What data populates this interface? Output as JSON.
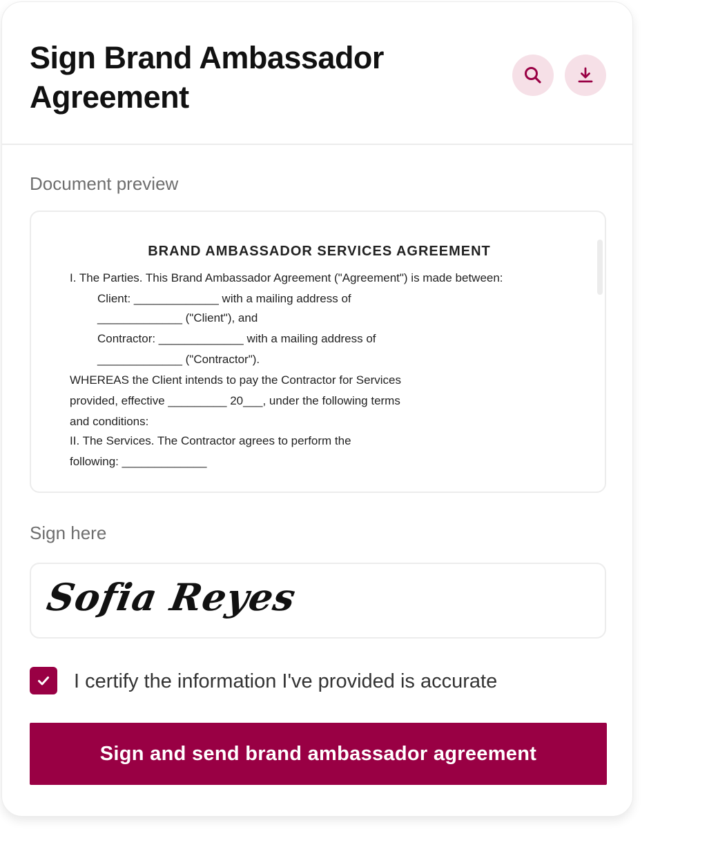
{
  "header": {
    "title": "Sign Brand Ambassador Agreement",
    "search_icon": "search-icon",
    "download_icon": "download-icon"
  },
  "preview": {
    "label": "Document preview",
    "doc_title": "BRAND AMBASSADOR SERVICES AGREEMENT",
    "lines": [
      "I. The Parties. This Brand Ambassador Agreement (\"Agreement\") is made between:",
      "Client: _____________ with a mailing address of",
      "_____________ (\"Client\"), and",
      "Contractor: _____________ with a mailing address of",
      "_____________ (\"Contractor\").",
      "WHEREAS the Client intends to pay the Contractor for Services",
      "provided, effective _________ 20___, under the following terms",
      "and conditions:",
      "II. The Services. The Contractor agrees to perform the",
      "following: _____________"
    ]
  },
  "sign": {
    "label": "Sign here",
    "signature": "Sofia Reyes"
  },
  "certify": {
    "checked": true,
    "text": "I certify the information I've provided is accurate"
  },
  "submit": {
    "label": "Sign and send brand ambassador agreement"
  },
  "colors": {
    "accent": "#990044",
    "icon_bg": "#f6e0e7",
    "border": "#ececec"
  }
}
